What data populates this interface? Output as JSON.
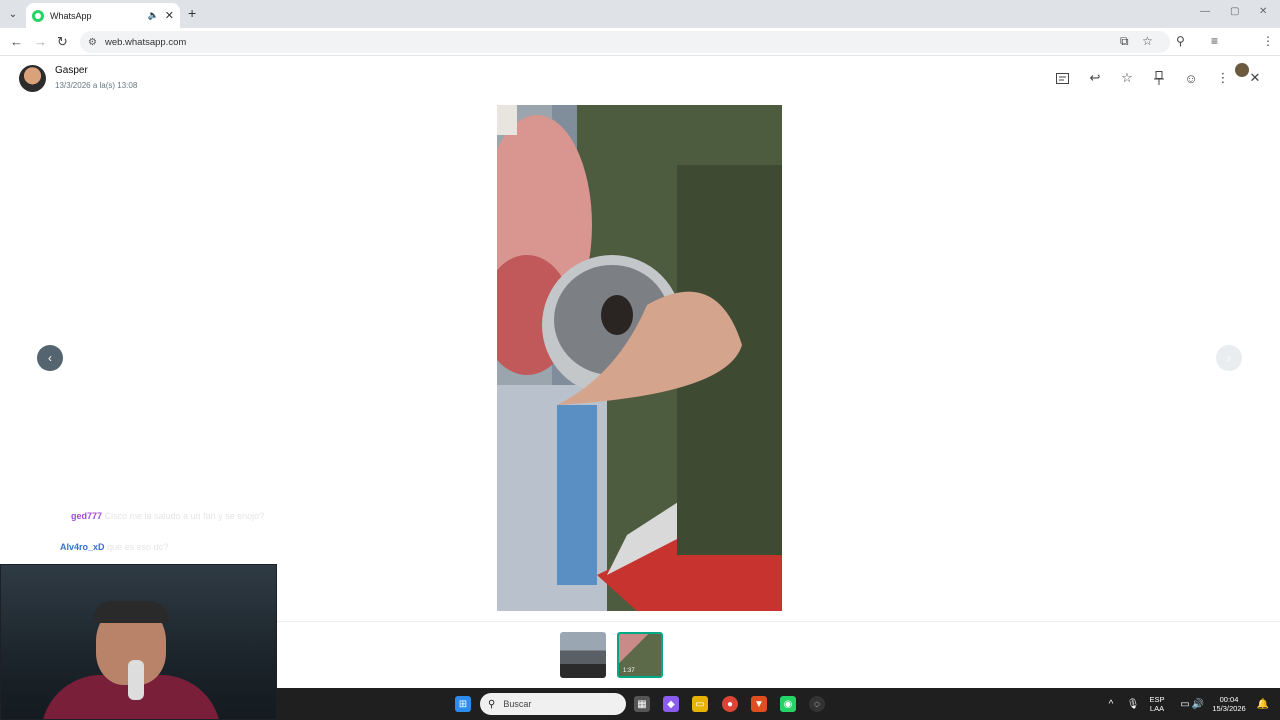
{
  "browser": {
    "tab_title": "WhatsApp",
    "url": "web.whatsapp.com"
  },
  "viewer": {
    "contact_name": "Gasper",
    "date": "13/3/2026 a la(s) 13:08",
    "actions": [
      "fit-icon",
      "reply-icon",
      "star-icon",
      "pin-icon",
      "emoji-icon",
      "more-icon",
      "close-icon"
    ]
  },
  "chat_overlay": [
    {
      "user": "ged777",
      "user_color": "#a24bd6",
      "message": "Cisco me la saludo a un fan y se enojo?"
    },
    {
      "user": "Alv4ro_xD",
      "user_color": "#3a6fd0",
      "message": "que es eso dc?"
    }
  ],
  "thumbnails": [
    {
      "type": "image"
    },
    {
      "type": "video",
      "duration": "1:37",
      "selected": true
    }
  ],
  "taskbar": {
    "search_placeholder": "Buscar",
    "lang_top": "ESP",
    "lang_bottom": "LAA",
    "time": "00:04",
    "date": "15/3/2026"
  },
  "colors": {
    "accent": "#00a884",
    "taskbar": "#1f1f1f"
  }
}
